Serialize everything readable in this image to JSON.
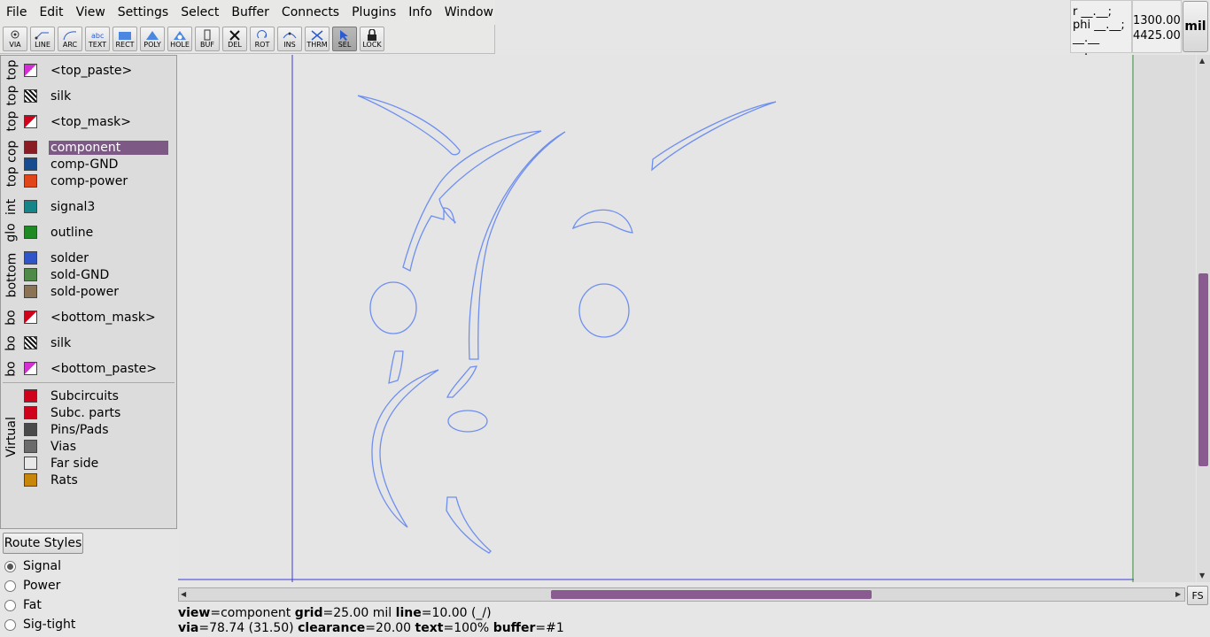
{
  "menu": [
    "File",
    "Edit",
    "View",
    "Settings",
    "Select",
    "Buffer",
    "Connects",
    "Plugins",
    "Info",
    "Window"
  ],
  "tools": [
    {
      "label": "VIA",
      "icon": "via-icon"
    },
    {
      "label": "LINE",
      "icon": "line-icon"
    },
    {
      "label": "ARC",
      "icon": "arc-icon"
    },
    {
      "label": "TEXT",
      "icon": "text-icon"
    },
    {
      "label": "RECT",
      "icon": "rect-icon"
    },
    {
      "label": "POLY",
      "icon": "poly-icon"
    },
    {
      "label": "HOLE",
      "icon": "hole-icon"
    },
    {
      "label": "BUF",
      "icon": "buffer-icon"
    },
    {
      "label": "DEL",
      "icon": "delete-icon"
    },
    {
      "label": "ROT",
      "icon": "rotate-icon"
    },
    {
      "label": "INS",
      "icon": "insert-icon"
    },
    {
      "label": "THRM",
      "icon": "thermal-icon"
    },
    {
      "label": "SEL",
      "icon": "select-arrow-icon",
      "active": true
    },
    {
      "label": "LOCK",
      "icon": "lock-icon"
    }
  ],
  "crosshair": {
    "r": "r __.__;",
    "phi": "phi __.__;",
    "tail": "__.__ __.__"
  },
  "coords": {
    "x": "1300.00",
    "y": "4425.00"
  },
  "unit": "mil",
  "layer_groups": [
    {
      "tab": "top",
      "layers": [
        {
          "name": "<top_paste>",
          "swatch": "pink-tri"
        }
      ]
    },
    {
      "tab": "top",
      "layers": [
        {
          "name": "silk",
          "swatch": "hatch"
        }
      ]
    },
    {
      "tab": "top",
      "layers": [
        {
          "name": "<top_mask>",
          "swatch": "red-tri"
        }
      ]
    },
    {
      "tab": "top cop",
      "layers": [
        {
          "name": "component",
          "color": "#8a1c24",
          "selected": true
        },
        {
          "name": "comp-GND",
          "color": "#174d8f"
        },
        {
          "name": "comp-power",
          "color": "#e0461a"
        }
      ]
    },
    {
      "tab": "int",
      "layers": [
        {
          "name": "signal3",
          "color": "#16858a"
        }
      ]
    },
    {
      "tab": "glo",
      "layers": [
        {
          "name": "outline",
          "color": "#1e8a23"
        }
      ]
    },
    {
      "tab": "bottom",
      "layers": [
        {
          "name": "solder",
          "color": "#2f55c9"
        },
        {
          "name": "sold-GND",
          "color": "#4f8a48"
        },
        {
          "name": "sold-power",
          "color": "#8b7355"
        }
      ]
    },
    {
      "tab": "bo",
      "layers": [
        {
          "name": "<bottom_mask>",
          "swatch": "red-tri"
        }
      ]
    },
    {
      "tab": "bo",
      "layers": [
        {
          "name": "silk",
          "swatch": "hatch"
        }
      ]
    },
    {
      "tab": "bo",
      "layers": [
        {
          "name": "<bottom_paste>",
          "swatch": "pink-tri"
        }
      ]
    }
  ],
  "virtual": {
    "tab": "Virtual",
    "layers": [
      {
        "name": "Subcircuits",
        "color": "#d0021b"
      },
      {
        "name": "Subc. parts",
        "color": "#d0021b"
      },
      {
        "name": "Pins/Pads",
        "color": "#4a4a4a"
      },
      {
        "name": "Vias",
        "color": "#6b6b6b"
      },
      {
        "name": "Far side",
        "color": "#e8e8e8"
      },
      {
        "name": "Rats",
        "color": "#c8860b"
      }
    ]
  },
  "route_styles": {
    "button": "Route Styles",
    "options": [
      {
        "label": "Signal",
        "checked": true
      },
      {
        "label": "Power"
      },
      {
        "label": "Fat"
      },
      {
        "label": "Sig-tight"
      }
    ]
  },
  "fs_label": "FS",
  "status": {
    "line1": [
      {
        "k": "view",
        "v": "component"
      },
      {
        "k": "grid",
        "v": "25.00 mil"
      },
      {
        "k": "line",
        "v": "10.00 (_/)"
      }
    ],
    "line2": [
      {
        "k": "via",
        "v": "78.74 (31.50)"
      },
      {
        "k": "clearance",
        "v": "20.00"
      },
      {
        "k": "text",
        "v": "100%"
      },
      {
        "k": "buffer",
        "v": "#1"
      }
    ]
  },
  "colors": {
    "outline_stroke": "#6e8ff0",
    "crosshair": "#3b3bd6",
    "selected": "#7d5986",
    "scroll_thumb": "#8a5b90"
  }
}
